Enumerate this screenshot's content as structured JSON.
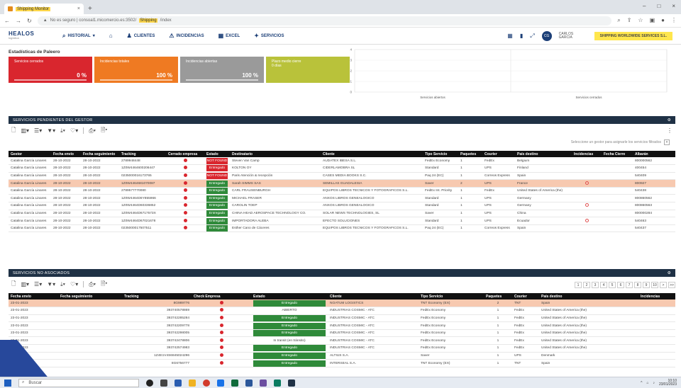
{
  "browser": {
    "tab_title": "Shipping Monitor",
    "url_prefix": "No es seguro | consoal1.micomercio.es:3502/",
    "url_highlight": "Shipping",
    "url_suffix": "/index"
  },
  "nav": {
    "logo_main": "HEALOS",
    "logo_sub": "logística",
    "items": [
      {
        "label": "HISTORIAL",
        "icon": "search-icon"
      },
      {
        "label": "CLIENTES",
        "icon": "people-icon"
      },
      {
        "label": "INCIDENCIAS",
        "icon": "warning-icon"
      },
      {
        "label": "EXCEL",
        "icon": "excel-icon"
      },
      {
        "label": "SERVICIOS",
        "icon": "tools-icon"
      }
    ],
    "user_name": "CARLOS GARCIA",
    "company": "SHIPPING WORLDWIDE SERVICES S.L."
  },
  "stats": {
    "title": "Estadísticas de Paleero",
    "cards": [
      {
        "label": "Servicios cerrados",
        "value": "0 %",
        "color": "#d9262e"
      },
      {
        "label": "Incidencias totales",
        "value": "100 %",
        "color": "#ef7a22"
      },
      {
        "label": "Incidencias abiertas",
        "value": "100 %",
        "color": "#9a9a9a"
      },
      {
        "label": "Plazo medio cierre",
        "value": "",
        "sub": "0 días",
        "color": "#b9c23a"
      }
    ]
  },
  "chart_data": {
    "type": "bar",
    "categories": [
      "Servicios abiertos",
      "Servicios cerrados"
    ],
    "values": [
      0,
      0
    ],
    "ylim": [
      0,
      4
    ],
    "yticks": [
      "4",
      "3",
      "2",
      "1",
      "0"
    ]
  },
  "pending": {
    "title": "SERVICIOS PENDIENTES DEL GESTOR",
    "hint": "Seleccione un gestor para asignarle los servicios filtrados",
    "columns": [
      "Gestor",
      "Fecha envío",
      "Fecha seguimiento",
      "Tracking",
      "Cerrado empresa",
      "Estado",
      "Destinatario",
      "Cliente",
      "Tipo Servicio",
      "Paquetes",
      "Courier",
      "País destino",
      "Incidencias",
      "Fecha Cierre",
      "Albarán"
    ],
    "rows": [
      {
        "gestor": "Catalina García Linares",
        "envio": "28-10-2022",
        "seg": "28-10-2022",
        "tracking": "2789948448",
        "estado": "NOT FOUND",
        "st": "nf",
        "dest": "Steven Van Camp",
        "cliente": "AUDATEX IBESA S.L.",
        "tipo": "FedEx Economy",
        "paq": "1",
        "courier": "FedEx",
        "pais": "Belgium",
        "inc": false,
        "alb": "800000562"
      },
      {
        "gestor": "Catalina García Linares",
        "envio": "28-10-2022",
        "seg": "28-10-2022",
        "tracking": "1Z0W4464600206447",
        "estado": "Entregado",
        "st": "nf",
        "dest": "KOLTON OY",
        "cliente": "CIDERLAMOBRA SL",
        "tipo": "Standard",
        "paq": "1",
        "courier": "UPS",
        "pais": "Finland",
        "inc": false,
        "alb": "400454"
      },
      {
        "gestor": "Catalina García Linares",
        "envio": "28-10-2022",
        "seg": "28-10-2022",
        "tracking": "0235000016173765",
        "estado": "NOT FOUND",
        "st": "nf",
        "dest": "Paris Atención & recepción",
        "cliente": "CASES MEDIA BOOKS S.C.",
        "tipo": "Paq 24 (EC)",
        "paq": "1",
        "courier": "Correos Express",
        "pais": "Spain",
        "inc": false,
        "alb": "540409"
      },
      {
        "gestor": "Catalina García Linares",
        "envio": "28-10-2022",
        "seg": "28-10-2022",
        "tracking": "1Z0W4464681070087",
        "estado": "Entregado",
        "st": "ent",
        "dest": "Sarah SIMMS SAS",
        "cliente": "SEMILLAS GUADALESIA",
        "tipo": "Saver",
        "paq": "2",
        "courier": "UPS",
        "pais": "France",
        "inc": true,
        "alb": "800927",
        "hl": true
      },
      {
        "gestor": "Catalina García Linares",
        "envio": "28-10-2022",
        "seg": "28-10-2022",
        "tracking": "2789577770080",
        "estado": "Entregado",
        "st": "ent",
        "dest": "CARL FRAUSENBURGH",
        "cliente": "EQUIPOS LIBROS TECNICOS Y FOTOGRAFICOS S.L.",
        "tipo": "FedEx Int. Priority",
        "paq": "1",
        "courier": "FedEx",
        "pais": "United States of America (the)",
        "inc": false,
        "alb": "540438"
      },
      {
        "gestor": "Catalina García Linares",
        "envio": "28-10-2022",
        "seg": "28-10-2022",
        "tracking": "1Z0W4464D6Y855966",
        "estado": "Entregado",
        "st": "ent",
        "dest": "MICHAEL FRASER",
        "cliente": "ANXOS LIBROS GENEALOGICO",
        "tipo": "Standard",
        "paq": "1",
        "courier": "UPS",
        "pais": "Germany",
        "inc": false,
        "alb": "800860562"
      },
      {
        "gestor": "Catalina García Linares",
        "envio": "28-10-2022",
        "seg": "28-10-2022",
        "tracking": "1Z0W4464D60336852",
        "estado": "Entregado",
        "st": "ent",
        "dest": "CAROLIN TOEP",
        "cliente": "ANXOS LIBROS GENEALOGICO",
        "tipo": "Standard",
        "paq": "1",
        "courier": "UPS",
        "pais": "Germany",
        "inc": true,
        "alb": "800860563"
      },
      {
        "gestor": "Catalina García Linares",
        "envio": "28-10-2022",
        "seg": "28-10-2022",
        "tracking": "1Z0W4464D6717573X",
        "estado": "Entregado",
        "st": "ent",
        "dest": "CHINA HEAD AEROSPACE TECHNOLOGY CO.",
        "cliente": "SOLAR NEWS TECHNOLOGIES, SL",
        "tipo": "Saver",
        "paq": "1",
        "courier": "UPS",
        "pais": "China",
        "inc": false,
        "alb": "800000284"
      },
      {
        "gestor": "Catalina García Linares",
        "envio": "28-10-2022",
        "seg": "28-10-2022",
        "tracking": "1Z0W4464D67021678",
        "estado": "Entregado",
        "st": "ent",
        "dest": "IMPORTADORA ALEBA",
        "cliente": "EFECTO SOLUCIONES",
        "tipo": "Standard",
        "paq": "1",
        "courier": "UPS",
        "pais": "Ecuador",
        "inc": true,
        "alb": "540463"
      },
      {
        "gestor": "Catalina García Linares",
        "envio": "28-10-2022",
        "seg": "28-10-2022",
        "tracking": "0235000017507511",
        "estado": "Entregado",
        "st": "ent",
        "dest": "Esther Cano de Cáceres",
        "cliente": "EQUIPOS LIBROS TECNICOS Y FOTOGRAFICOS S.L.",
        "tipo": "Paq 24 (EC)",
        "paq": "1",
        "courier": "Correos Express",
        "pais": "Spain",
        "inc": false,
        "alb": "540437"
      }
    ]
  },
  "unassigned": {
    "title": "SERVICIOS NO ASOCIADOS",
    "pages": [
      "1",
      "2",
      "3",
      "4",
      "5",
      "6",
      "7",
      "8",
      "9",
      "10",
      ">",
      ">>"
    ],
    "columns": [
      "Fecha envío",
      "Fecha seguimiento",
      "Tracking",
      "Check Empresa",
      "Estado",
      "Cliente",
      "Tipo Servicio",
      "Paquetes",
      "Courier",
      "País destino",
      "Incidencias"
    ],
    "rows": [
      {
        "envio": "23-01-2023",
        "seg": "",
        "tracking": "8G989776",
        "estado": "Entregado",
        "st": "ent",
        "cliente": "NOATUM LOGISTICS",
        "tipo": "TNT Economy (EX)",
        "paq": "2",
        "courier": "TNT",
        "pais": "Spain",
        "hl": true
      },
      {
        "envio": "23-01-2023",
        "seg": "",
        "tracking": "393740578869",
        "estado": "ABIERTO",
        "st": "plain",
        "cliente": "INDUSTRIAS COSMIC - ATC",
        "tipo": "FedEx Economy",
        "paq": "1",
        "courier": "FedEx",
        "pais": "United States of America (the)"
      },
      {
        "envio": "23-01-2023",
        "seg": "",
        "tracking": "393742285284",
        "estado": "Entregado",
        "st": "ent",
        "cliente": "INDUSTRIAS COSMIC - ATC",
        "tipo": "FedEx Economy",
        "paq": "1",
        "courier": "FedEx",
        "pais": "United States of America (the)"
      },
      {
        "envio": "23-01-2023",
        "seg": "",
        "tracking": "393742209778",
        "estado": "Entregado",
        "st": "ent",
        "cliente": "INDUSTRIAS COSMIC - ATC",
        "tipo": "FedEx Economy",
        "paq": "1",
        "courier": "FedEx",
        "pais": "United States of America (the)"
      },
      {
        "envio": "23-01-2023",
        "seg": "",
        "tracking": "393742298005",
        "estado": "Entregado",
        "st": "ent",
        "cliente": "INDUSTRIAS COSMIC - ATC",
        "tipo": "FedEx Economy",
        "paq": "1",
        "courier": "FedEx",
        "pais": "United States of America (the)"
      },
      {
        "envio": "23-01-2023",
        "seg": "",
        "tracking": "393742478806",
        "estado": "In transit (en tránsito)",
        "st": "plain",
        "cliente": "INDUSTRIAS COSMIC - ATC",
        "tipo": "FedEx Economy",
        "paq": "1",
        "courier": "FedEx",
        "pais": "United States of America (the)"
      },
      {
        "envio": "23-01-2023",
        "seg": "",
        "tracking": "393742574983",
        "estado": "Entregado",
        "st": "ent",
        "cliente": "INDUSTRIAS COSMIC - ATC",
        "tipo": "FedEx Economy",
        "paq": "1",
        "courier": "FedEx",
        "pais": "United States of America (the)"
      },
      {
        "envio": "23-01-2023",
        "seg": "",
        "tracking": "1Z4E1V4S6845024296",
        "estado": "Entregado",
        "st": "ent",
        "cliente": "ALTIUS S.A.",
        "tipo": "Saver",
        "paq": "1",
        "courier": "UPS",
        "pais": "Denmark"
      },
      {
        "envio": "23-01-2023",
        "seg": "",
        "tracking": "8G6756777",
        "estado": "Entregado",
        "st": "ent",
        "cliente": "INTERSEAL S.A.",
        "tipo": "TNT Economy (EX)",
        "paq": "1",
        "courier": "TNT",
        "pais": "Spain"
      }
    ]
  },
  "taskbar": {
    "search_placeholder": "Buscar",
    "time": "10:10",
    "date": "23/01/2023"
  }
}
